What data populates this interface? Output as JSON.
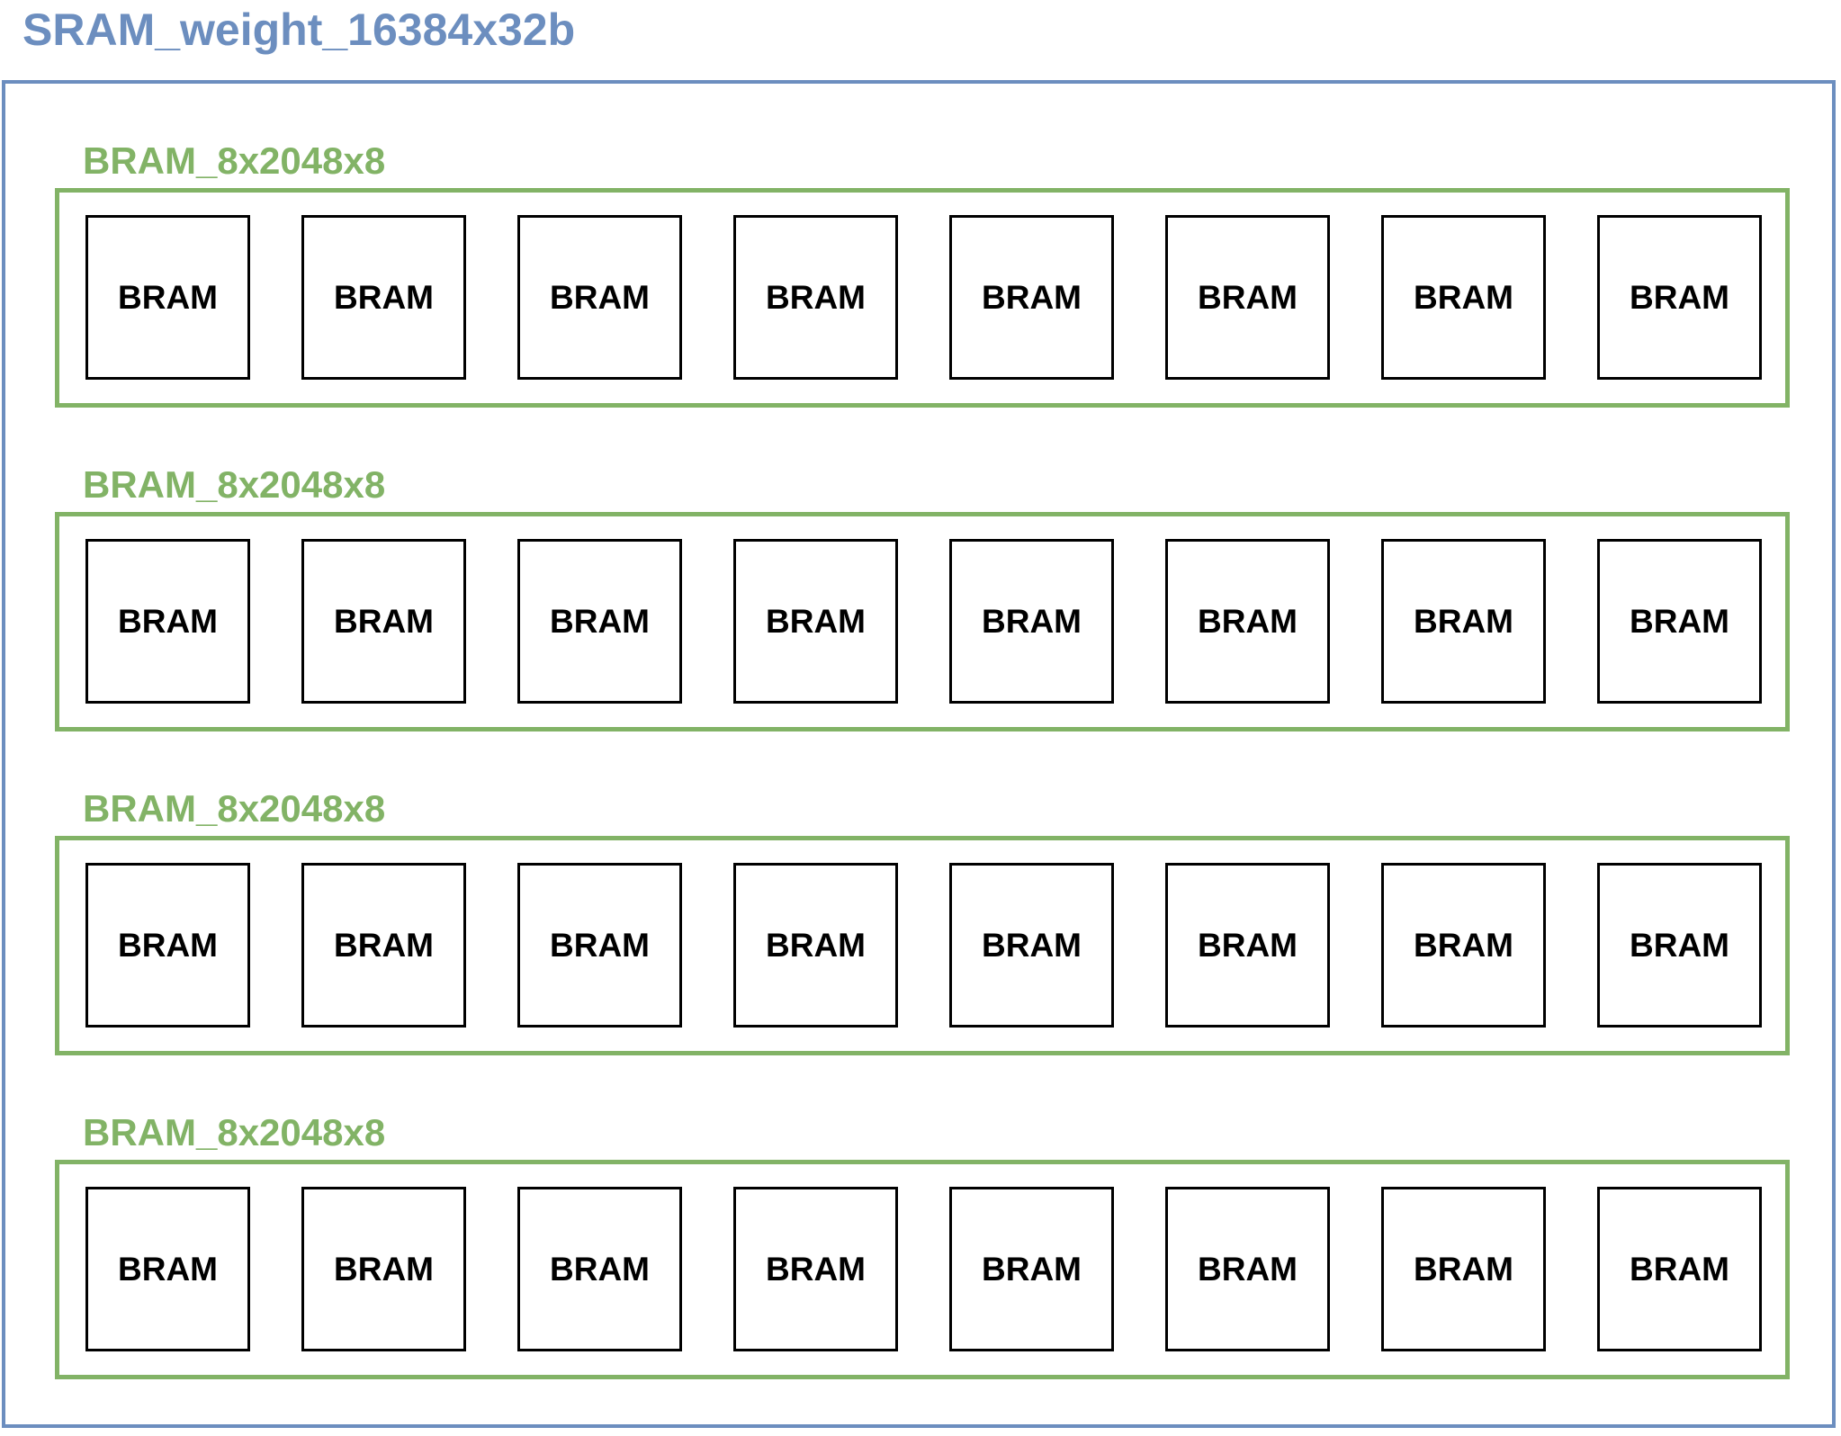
{
  "title": "SRAM_weight_16384x32b",
  "groups": [
    {
      "label": "BRAM_8x2048x8",
      "blocks": [
        "BRAM",
        "BRAM",
        "BRAM",
        "BRAM",
        "BRAM",
        "BRAM",
        "BRAM",
        "BRAM"
      ]
    },
    {
      "label": "BRAM_8x2048x8",
      "blocks": [
        "BRAM",
        "BRAM",
        "BRAM",
        "BRAM",
        "BRAM",
        "BRAM",
        "BRAM",
        "BRAM"
      ]
    },
    {
      "label": "BRAM_8x2048x8",
      "blocks": [
        "BRAM",
        "BRAM",
        "BRAM",
        "BRAM",
        "BRAM",
        "BRAM",
        "BRAM",
        "BRAM"
      ]
    },
    {
      "label": "BRAM_8x2048x8",
      "blocks": [
        "BRAM",
        "BRAM",
        "BRAM",
        "BRAM",
        "BRAM",
        "BRAM",
        "BRAM",
        "BRAM"
      ]
    }
  ],
  "colors": {
    "outer": "#6c8ebf",
    "group": "#82b366",
    "block": "#000000"
  }
}
